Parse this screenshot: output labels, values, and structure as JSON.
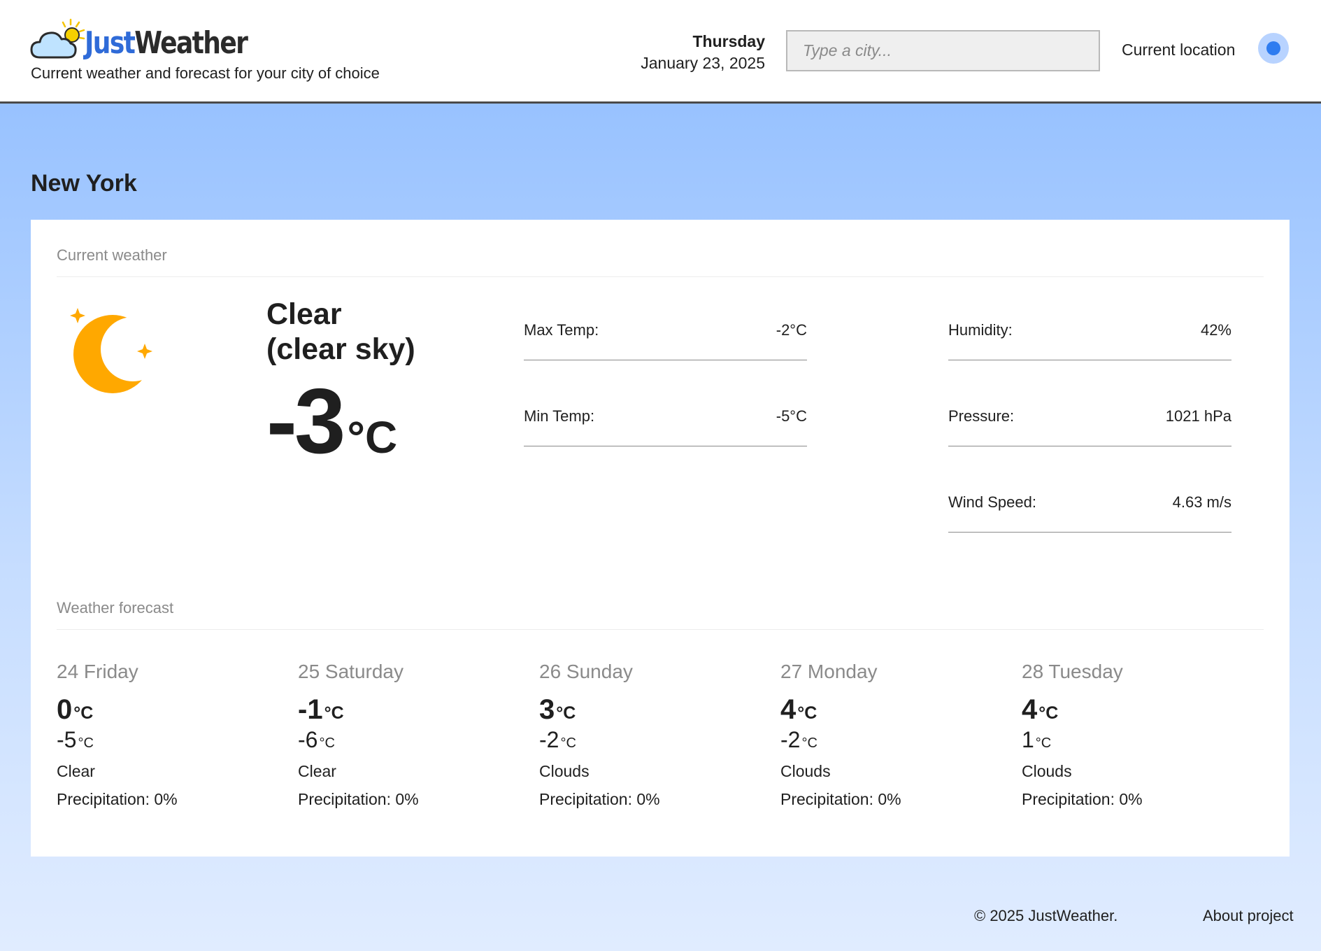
{
  "header": {
    "logo": {
      "word1": "Just",
      "word2": "Weather"
    },
    "tagline": "Current weather and forecast for your city of choice",
    "day": "Thursday",
    "date": "January 23, 2025",
    "search_placeholder": "Type a city...",
    "current_location_label": "Current location"
  },
  "city": "New York",
  "current": {
    "section_title": "Current weather",
    "icon": "crescent-moon-icon",
    "description_line1": "Clear",
    "description_line2": "(clear sky)",
    "temp": "-3",
    "temp_unit": "°C",
    "stats_left": [
      {
        "label": "Max Temp:",
        "value": "-2°C"
      },
      {
        "label": "Min Temp:",
        "value": "-5°C"
      }
    ],
    "stats_right": [
      {
        "label": "Humidity:",
        "value": "42%"
      },
      {
        "label": "Pressure:",
        "value": "1021 hPa"
      },
      {
        "label": "Wind Speed:",
        "value": "4.63 m/s"
      }
    ]
  },
  "forecast": {
    "section_title": "Weather forecast",
    "days": [
      {
        "day": "24 Friday",
        "max": "0",
        "min": "-5",
        "unit": "°C",
        "condition": "Clear",
        "precipitation": "Precipitation: 0%"
      },
      {
        "day": "25 Saturday",
        "max": "-1",
        "min": "-6",
        "unit": "°C",
        "condition": "Clear",
        "precipitation": "Precipitation: 0%"
      },
      {
        "day": "26 Sunday",
        "max": "3",
        "min": "-2",
        "unit": "°C",
        "condition": "Clouds",
        "precipitation": "Precipitation: 0%"
      },
      {
        "day": "27 Monday",
        "max": "4",
        "min": "-2",
        "unit": "°C",
        "condition": "Clouds",
        "precipitation": "Precipitation: 0%"
      },
      {
        "day": "28 Tuesday",
        "max": "4",
        "min": "1",
        "unit": "°C",
        "condition": "Clouds",
        "precipitation": "Precipitation: 0%"
      }
    ]
  },
  "footer": {
    "copyright": "© 2025 JustWeather.",
    "about": "About project"
  },
  "colors": {
    "accent": "#2e7cf0",
    "moon": "#ffa800",
    "background_top": "#98c2ff",
    "background_bottom": "#e0ecff"
  }
}
